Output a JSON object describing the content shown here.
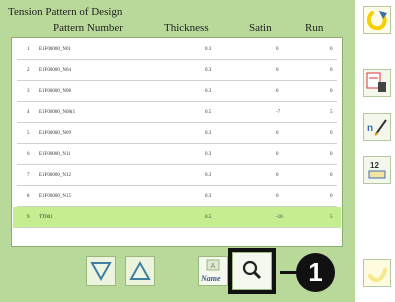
{
  "title": "Tension Pattern of Design",
  "columns": {
    "pattern": "Pattern Number",
    "thickness": "Thickness",
    "satin": "Satin",
    "run": "Run"
  },
  "rows": [
    {
      "num": "1",
      "name": "E1F00000_N01",
      "thickness": "0.3",
      "satin": "0",
      "run": "0",
      "selected": false
    },
    {
      "num": "2",
      "name": "E1F00000_N04",
      "thickness": "0.3",
      "satin": "0",
      "run": "0",
      "selected": false
    },
    {
      "num": "3",
      "name": "E1F00000_N08",
      "thickness": "0.3",
      "satin": "0",
      "run": "0",
      "selected": false
    },
    {
      "num": "4",
      "name": "E1F00000_N08(1",
      "thickness": "0.5",
      "satin": "-7",
      "run": "5",
      "selected": false
    },
    {
      "num": "5",
      "name": "E1F00000_N09",
      "thickness": "0.3",
      "satin": "0",
      "run": "0",
      "selected": false
    },
    {
      "num": "6",
      "name": "E1F00000_N11",
      "thickness": "0.3",
      "satin": "0",
      "run": "0",
      "selected": false
    },
    {
      "num": "7",
      "name": "E1F00000_N12",
      "thickness": "0.3",
      "satin": "0",
      "run": "0",
      "selected": false
    },
    {
      "num": "8",
      "name": "E1F00000_N15",
      "thickness": "0.3",
      "satin": "0",
      "run": "0",
      "selected": false
    },
    {
      "num": "9",
      "name": "TT001",
      "thickness": "0.5",
      "satin": "-10",
      "run": "5",
      "selected": true
    }
  ],
  "buttons": {
    "name_label": "Name",
    "callout": "1"
  },
  "icons": [
    "return-icon",
    "delete-icon",
    "edit-icon",
    "size-icon",
    "confirm-icon",
    "search-icon",
    "scroll-down-icon",
    "scroll-up-icon"
  ],
  "colors": {
    "background": "#b8d99a",
    "selected_row": "#c4ee8f",
    "accent_yellow": "#f5d000"
  }
}
